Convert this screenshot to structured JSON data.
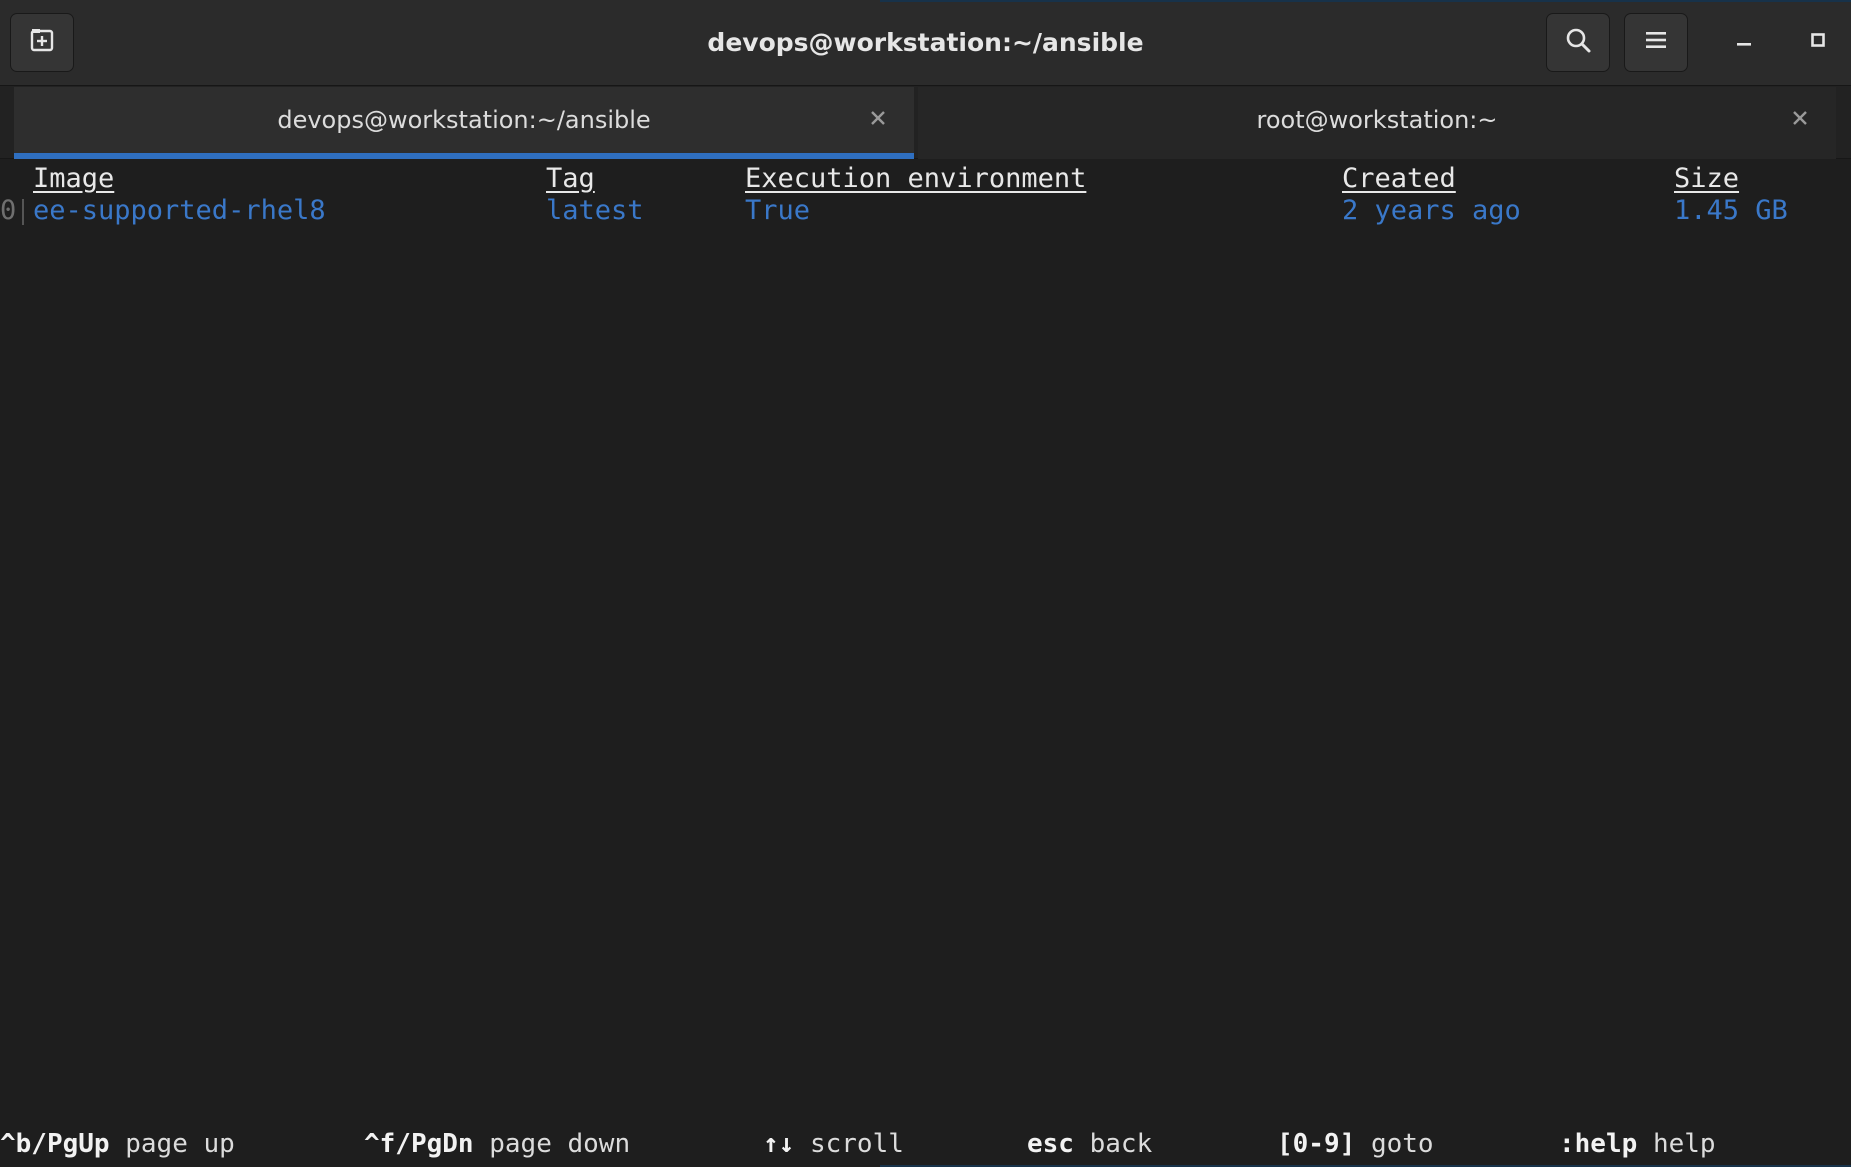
{
  "window": {
    "title": "devops@workstation:~/ansible"
  },
  "header": {
    "new_tab_icon": "new-tab-icon",
    "search_icon": "search-icon",
    "menu_icon": "hamburger-menu-icon",
    "minimize_icon": "minimize-icon",
    "maximize_icon": "maximize-icon"
  },
  "tabs": [
    {
      "label": "devops@workstation:~/ansible",
      "active": true,
      "close_icon": "close-icon"
    },
    {
      "label": "root@workstation:~",
      "active": false,
      "close_icon": "close-icon"
    }
  ],
  "table": {
    "columns": [
      "Image",
      "Tag",
      "Execution environment",
      "Created",
      "Size"
    ],
    "rows": [
      {
        "index": "0",
        "cells": [
          "ee-supported-rhel8",
          "latest",
          "True",
          "2 years ago",
          "1.45 GB"
        ]
      }
    ]
  },
  "footer": {
    "keys": [
      {
        "key": "^b/PgUp",
        "action": "page up"
      },
      {
        "key": "^f/PgDn",
        "action": "page down"
      },
      {
        "key": "↑↓",
        "action": "scroll"
      },
      {
        "key": "esc",
        "action": "back"
      },
      {
        "key": "[0-9]",
        "action": "goto"
      },
      {
        "key": ":help",
        "action": "help"
      }
    ]
  },
  "colors": {
    "accent": "#2f6fc0",
    "value_text": "#3a78c9",
    "background": "#1e1e1e"
  }
}
